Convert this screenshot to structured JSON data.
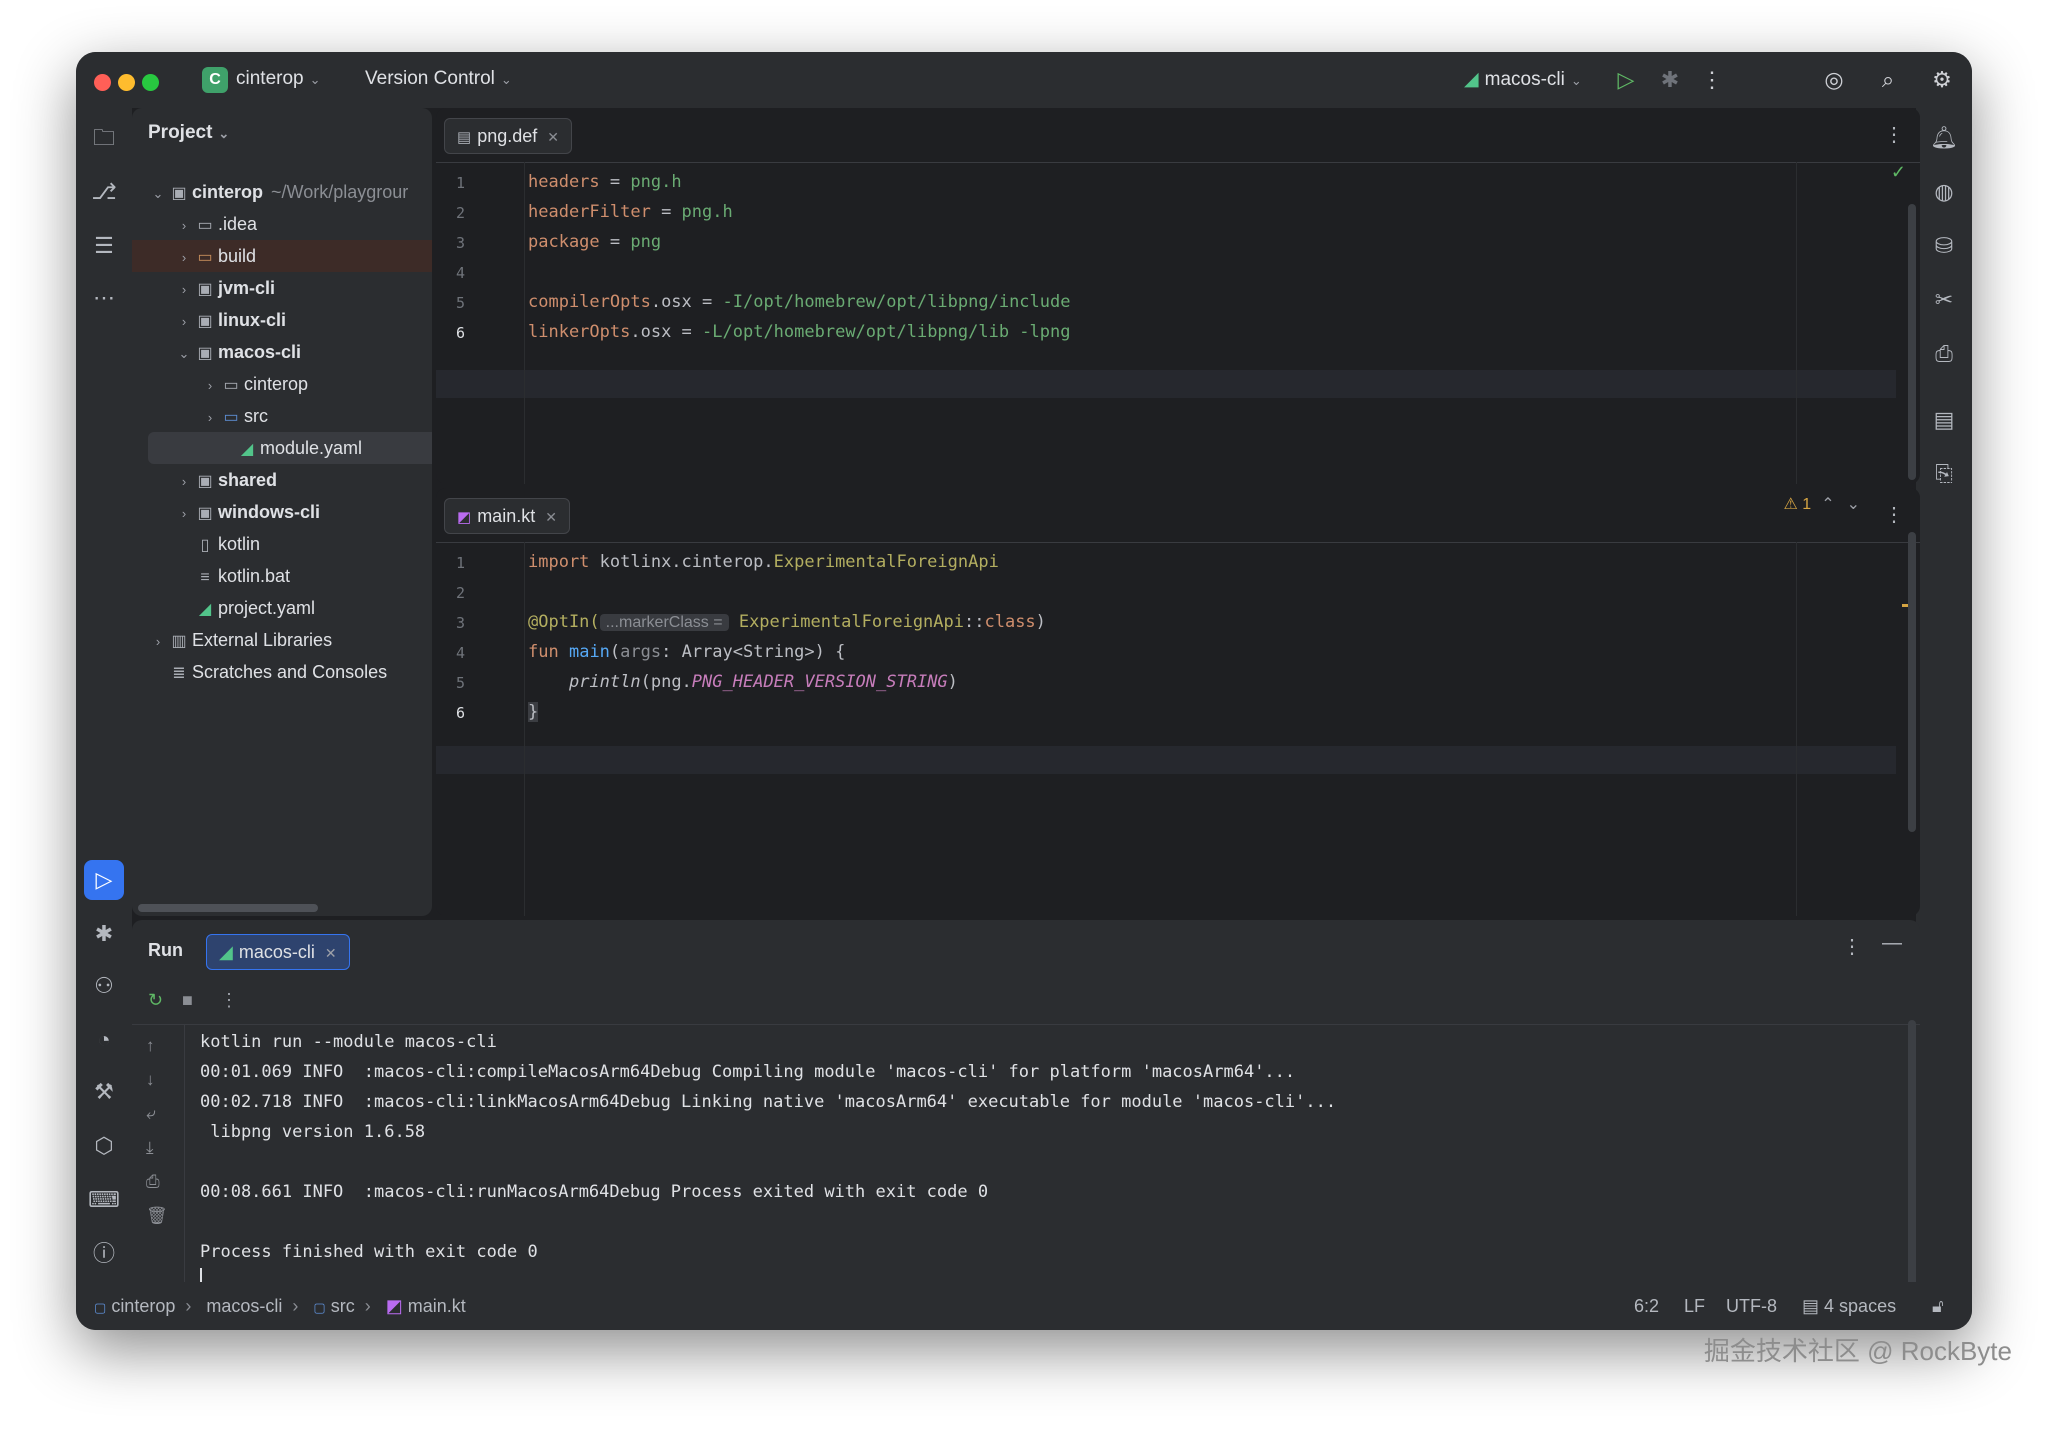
{
  "titlebar": {
    "project_badge": "C",
    "project_name": "cinterop",
    "vcs_label": "Version Control",
    "run_config": "macos-cli"
  },
  "project_panel": {
    "title": "Project",
    "tree": [
      {
        "label": "cinterop",
        "extra": "~/Work/playgrour",
        "bold": true
      },
      {
        "label": ".idea"
      },
      {
        "label": "build"
      },
      {
        "label": "jvm-cli",
        "bold": true
      },
      {
        "label": "linux-cli",
        "bold": true
      },
      {
        "label": "macos-cli",
        "bold": true
      },
      {
        "label": "cinterop"
      },
      {
        "label": "src"
      },
      {
        "label": "module.yaml"
      },
      {
        "label": "shared",
        "bold": true
      },
      {
        "label": "windows-cli",
        "bold": true
      },
      {
        "label": "kotlin"
      },
      {
        "label": "kotlin.bat"
      },
      {
        "label": "project.yaml"
      },
      {
        "label": "External Libraries"
      },
      {
        "label": "Scratches and Consoles"
      }
    ]
  },
  "editor_top": {
    "tab": "png.def",
    "line_numbers": [
      "1",
      "2",
      "3",
      "4",
      "5",
      "6"
    ],
    "lines": [
      {
        "key": "headers",
        "op": " = ",
        "val": "png.h"
      },
      {
        "key": "headerFilter",
        "op": " = ",
        "val": "png.h"
      },
      {
        "key": "package",
        "op": " = ",
        "val": "png"
      },
      {
        "key": "",
        "op": "",
        "val": ""
      },
      {
        "key": "compilerOpts",
        "op2": ".osx",
        "op": " = ",
        "val": "-I/opt/homebrew/opt/libpng/include"
      },
      {
        "key": "linkerOpts",
        "op2": ".osx",
        "op": " = ",
        "val": "-L/opt/homebrew/opt/libpng/lib -lpng"
      }
    ]
  },
  "editor_bottom": {
    "tab": "main.kt",
    "warning_count": "1",
    "line_numbers": [
      "1",
      "2",
      "3",
      "4",
      "5",
      "6"
    ],
    "code": {
      "l1_kw": "import",
      "l1_pkg": " kotlinx.cinterop.",
      "l1_cls": "ExperimentalForeignApi",
      "l3_ann": "@OptIn(",
      "l3_hint": "...markerClass =",
      "l3_cls": "ExperimentalForeignApi",
      "l3_rest": "::",
      "l3_kw": "class",
      "l3_end": ")",
      "l4_kw": "fun",
      "l4_fn": "main",
      "l4_open": "(",
      "l4_param": "args",
      "l4_type": ": Array<String>) {",
      "l5_fn": "println",
      "l5_open": "(png.",
      "l5_const": "PNG_HEADER_VERSION_STRING",
      "l5_close": ")",
      "l6": "}"
    }
  },
  "run_panel": {
    "label": "Run",
    "tab": "macos-cli",
    "console": [
      "kotlin run --module macos-cli",
      "00:01.069 INFO  :macos-cli:compileMacosArm64Debug Compiling module 'macos-cli' for platform 'macosArm64'...",
      "00:02.718 INFO  :macos-cli:linkMacosArm64Debug Linking native 'macosArm64' executable for module 'macos-cli'...",
      " libpng version 1.6.58",
      "",
      "00:08.661 INFO  :macos-cli:runMacosArm64Debug Process exited with exit code 0",
      "",
      "Process finished with exit code 0"
    ]
  },
  "statusbar": {
    "breadcrumb": [
      "cinterop",
      "macos-cli",
      "src",
      "main.kt"
    ],
    "position": "6:2",
    "line_sep": "LF",
    "encoding": "UTF-8",
    "indent": "4 spaces"
  },
  "watermark": "掘金技术社区 @ RockByte",
  "colors": {
    "accent": "#3574f0",
    "bg": "#1e1f22",
    "panel": "#2b2d30"
  }
}
